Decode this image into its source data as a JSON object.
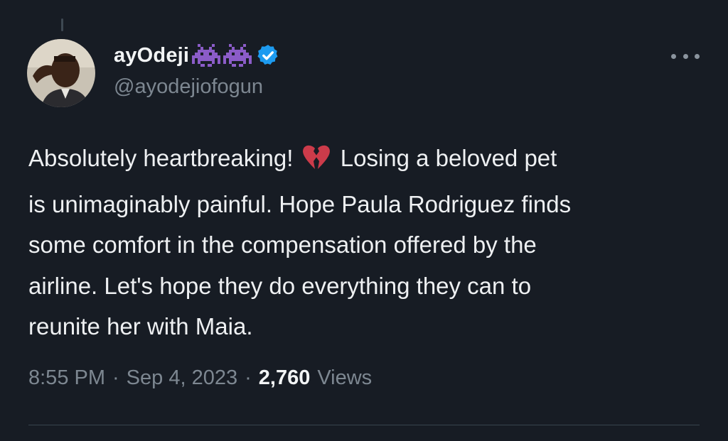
{
  "tweet": {
    "author": {
      "display_name": "ayOdeji",
      "name_emoji": "space-invader-emoji",
      "handle": "@ayodejiofogun",
      "verified": true,
      "avatar": "user-avatar"
    },
    "text_lines": {
      "line1_before": "Absolutely heartbreaking!",
      "line1_emoji": "broken-heart-emoji",
      "line1_after": "Losing a beloved pet",
      "line2": "is unimaginably painful. Hope Paula Rodriguez finds",
      "line3": "some comfort in the compensation offered by the",
      "line4": "airline. Let's hope they do everything they can to",
      "line5": "reunite her with Maia."
    },
    "time": "8:55 PM",
    "separator": "·",
    "date": "Sep 4, 2023",
    "views_count": "2,760",
    "views_label": "Views",
    "more_icon": "more-options-icon"
  },
  "colors": {
    "background": "#171c24",
    "text": "#eef0f2",
    "secondary_text": "#7d8791",
    "verified_blue": "#1d9bf0",
    "emoji_purple": "#8b5cc8",
    "broken_heart": "#cc3b4a"
  }
}
